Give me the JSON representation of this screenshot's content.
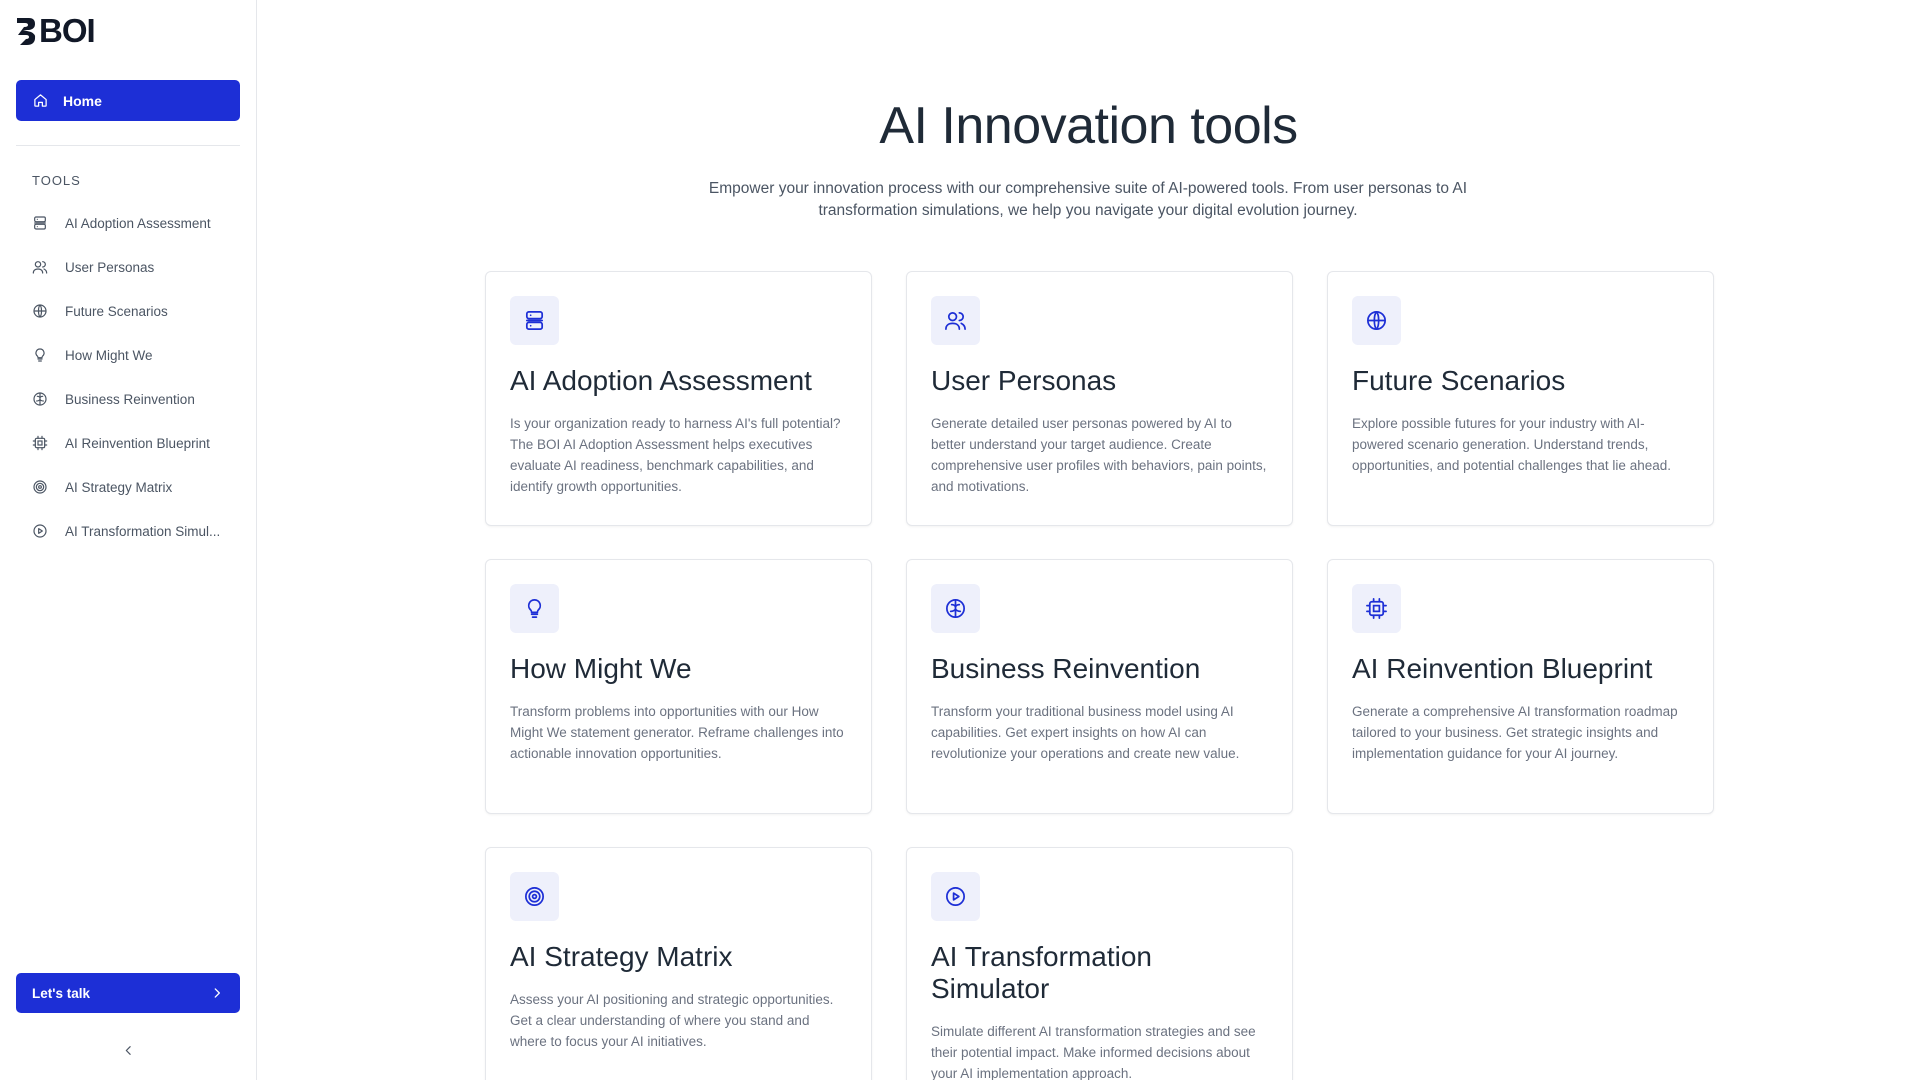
{
  "brand": {
    "logo_text": "BOI"
  },
  "sidebar": {
    "home_label": "Home",
    "tools_heading": "TOOLS",
    "items": [
      {
        "label": "AI Adoption Assessment",
        "icon": "server-icon"
      },
      {
        "label": "User Personas",
        "icon": "users-icon"
      },
      {
        "label": "Future Scenarios",
        "icon": "globe-icon"
      },
      {
        "label": "How Might We",
        "icon": "lightbulb-icon"
      },
      {
        "label": "Business Reinvention",
        "icon": "brain-icon"
      },
      {
        "label": "AI Reinvention Blueprint",
        "icon": "cpu-icon"
      },
      {
        "label": "AI Strategy Matrix",
        "icon": "target-icon"
      },
      {
        "label": "AI Transformation Simul...",
        "icon": "play-circle-icon"
      }
    ],
    "cta_label": "Let's talk"
  },
  "main": {
    "title": "AI Innovation tools",
    "subtitle": "Empower your innovation process with our comprehensive suite of AI-powered tools. From user personas to AI transformation simulations, we help you navigate your digital evolution journey.",
    "cards": [
      {
        "title": "AI Adoption Assessment",
        "description": "Is your organization ready to harness AI's full potential? The BOI AI Adoption Assessment helps executives evaluate AI readiness, benchmark capabilities, and identify growth opportunities.",
        "icon": "server-icon"
      },
      {
        "title": "User Personas",
        "description": "Generate detailed user personas powered by AI to better understand your target audience. Create comprehensive user profiles with behaviors, pain points, and motivations.",
        "icon": "users-icon"
      },
      {
        "title": "Future Scenarios",
        "description": "Explore possible futures for your industry with AI-powered scenario generation. Understand trends, opportunities, and potential challenges that lie ahead.",
        "icon": "globe-icon"
      },
      {
        "title": "How Might We",
        "description": "Transform problems into opportunities with our How Might We statement generator. Reframe challenges into actionable innovation opportunities.",
        "icon": "lightbulb-icon"
      },
      {
        "title": "Business Reinvention",
        "description": "Transform your traditional business model using AI capabilities. Get expert insights on how AI can revolutionize your operations and create new value.",
        "icon": "brain-icon"
      },
      {
        "title": "AI Reinvention Blueprint",
        "description": "Generate a comprehensive AI transformation roadmap tailored to your business. Get strategic insights and implementation guidance for your AI journey.",
        "icon": "cpu-icon"
      },
      {
        "title": "AI Strategy Matrix",
        "description": "Assess your AI positioning and strategic opportunities. Get a clear understanding of where you stand and where to focus your AI initiatives.",
        "icon": "target-icon"
      },
      {
        "title": "AI Transformation Simulator",
        "description": "Simulate different AI transformation strategies and see their potential impact. Make informed decisions about your AI implementation approach.",
        "icon": "play-circle-icon"
      }
    ]
  },
  "colors": {
    "accent": "#1d2fd6",
    "icon_bg": "#eef0fb",
    "text_dark": "#1f2a37",
    "text_muted": "#6b7280"
  }
}
